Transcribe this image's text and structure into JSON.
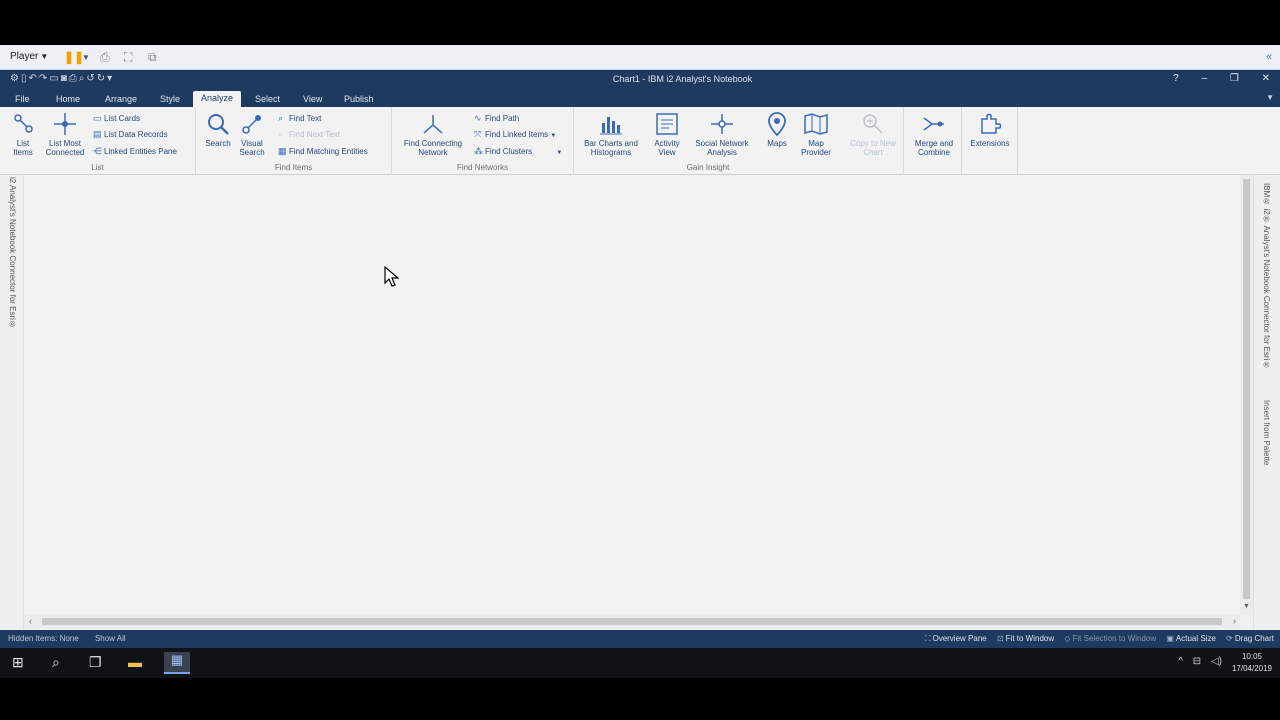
{
  "player": {
    "menu_label": "Player"
  },
  "window": {
    "title": "Chart1 - IBM i2 Analyst's Notebook"
  },
  "tabs": [
    {
      "label": "File"
    },
    {
      "label": "Home"
    },
    {
      "label": "Arrange"
    },
    {
      "label": "Style"
    },
    {
      "label": "Analyze"
    },
    {
      "label": "Select"
    },
    {
      "label": "View"
    },
    {
      "label": "Publish"
    }
  ],
  "ribbon": {
    "list": {
      "group_label": "List",
      "list_items": "List Items",
      "list_most_connected": "List Most Connected",
      "list_cards": "List Cards",
      "list_data_records": "List Data Records",
      "linked_entities_pane": "Linked Entities Pane"
    },
    "find_items": {
      "group_label": "Find Items",
      "search": "Search",
      "visual_search": "Visual Search",
      "find_text": "Find Text",
      "find_next_text": "Find Next Text",
      "find_matching_entities": "Find Matching Entities"
    },
    "find_networks": {
      "group_label": "Find Networks",
      "find_connecting_network": "Find Connecting Network",
      "find_path": "Find Path",
      "find_linked_items": "Find Linked Items",
      "find_clusters": "Find Clusters"
    },
    "gain_insight": {
      "group_label": "Gain Insight",
      "bar_charts": "Bar Charts and Histograms",
      "activity_view": "Activity View",
      "social_network_analysis": "Social Network Analysis",
      "maps": "Maps",
      "map_provider": "Map Provider",
      "copy_to_new_chart": "Copy to New Chart",
      "merge_and_combine": "Merge and Combine",
      "extensions": "Extensions"
    }
  },
  "side_panels": {
    "left": "i2 Analyst's Notebook Connector for Esri®",
    "right_top": "IBM® i2® Analyst's Notebook Connector for Esri®",
    "right_bottom": "Insert from Palette"
  },
  "status": {
    "hidden_items": "Hidden Items: None",
    "show_all": "Show All",
    "overview_pane": "Overview Pane",
    "fit_to_window": "Fit to Window",
    "fit_selection": "Fit Selection to Window",
    "actual_size": "Actual Size",
    "drag_chart": "Drag Chart"
  },
  "taskbar": {
    "time": "10:05",
    "date": "17/04/2019"
  },
  "colors": {
    "titlebar": "#1f3a5f",
    "ribbon": "#f2f2f2",
    "accent": "#27487a"
  }
}
